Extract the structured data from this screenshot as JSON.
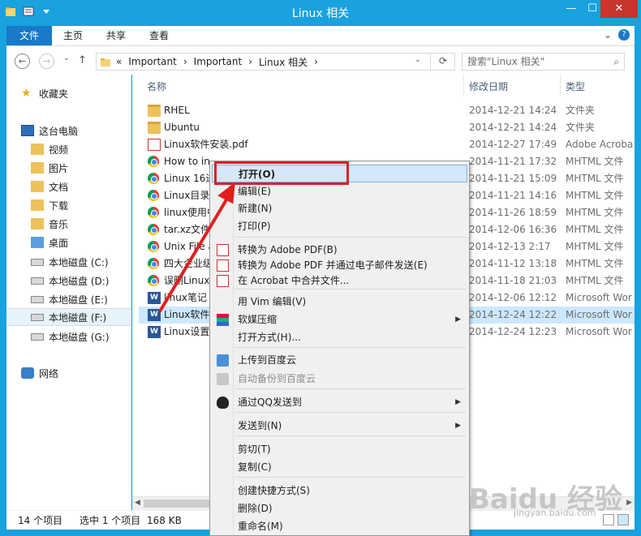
{
  "window": {
    "title": "Linux 相关"
  },
  "ribbon": {
    "tabs": [
      "文件",
      "主页",
      "共享",
      "查看"
    ]
  },
  "addressbar": {
    "path": [
      "«",
      "Important",
      "›",
      "Important",
      "›",
      "Linux 相关",
      "›"
    ],
    "search_placeholder": "搜索\"Linux 相关\""
  },
  "navpane": {
    "items": [
      {
        "label": "收藏夹",
        "icon": "star-icon"
      },
      {
        "label": "这台电脑",
        "icon": "computer-icon"
      },
      {
        "label": "视频",
        "icon": "folder-icon"
      },
      {
        "label": "图片",
        "icon": "folder-icon"
      },
      {
        "label": "文档",
        "icon": "folder-icon"
      },
      {
        "label": "下载",
        "icon": "folder-icon"
      },
      {
        "label": "音乐",
        "icon": "folder-icon"
      },
      {
        "label": "桌面",
        "icon": "folder-icon"
      },
      {
        "label": "本地磁盘 (C:)",
        "icon": "drive-icon"
      },
      {
        "label": "本地磁盘 (D:)",
        "icon": "drive-icon"
      },
      {
        "label": "本地磁盘 (E:)",
        "icon": "drive-icon"
      },
      {
        "label": "本地磁盘 (F:)",
        "icon": "drive-icon"
      },
      {
        "label": "本地磁盘 (G:)",
        "icon": "drive-icon"
      },
      {
        "label": "网络",
        "icon": "network-icon"
      }
    ]
  },
  "filelist": {
    "columns": {
      "name": "名称",
      "date": "修改日期",
      "type": "类型"
    },
    "rows": [
      {
        "name": "RHEL",
        "date": "2014-12-21 14:24",
        "type": "文件夹",
        "icon": "folder"
      },
      {
        "name": "Ubuntu",
        "date": "2014-12-21 14:24",
        "type": "文件夹",
        "icon": "folder"
      },
      {
        "name": "Linux软件安装.pdf",
        "date": "2014-12-27 17:49",
        "type": "Adobe Acroba",
        "icon": "pdf"
      },
      {
        "name": "How to in",
        "date": "2014-11-21 17:32",
        "type": "MHTML 文件",
        "icon": "chrome"
      },
      {
        "name": "Linux 16进",
        "date": "2014-11-21 15:09",
        "type": "MHTML 文件",
        "icon": "chrome"
      },
      {
        "name": "Linux目录",
        "date": "2014-11-21 14:16",
        "type": "MHTML 文件",
        "icon": "chrome"
      },
      {
        "name": "linux使用中",
        "date": "2014-11-26 18:59",
        "type": "MHTML 文件",
        "icon": "chrome"
      },
      {
        "name": "tar.xz文件",
        "date": "2014-12-06 16:36",
        "type": "MHTML 文件",
        "icon": "chrome"
      },
      {
        "name": "Unix File a",
        "date": "2014-12-13 2:17",
        "type": "MHTML 文件",
        "icon": "chrome"
      },
      {
        "name": "四大企业级",
        "date": "2014-11-12 13:18",
        "type": "MHTML 文件",
        "icon": "chrome"
      },
      {
        "name": "误删Linux",
        "date": "2014-11-18 21:03",
        "type": "MHTML 文件",
        "icon": "chrome"
      },
      {
        "name": "linux笔记",
        "date": "2014-12-06 12:12",
        "type": "Microsoft Wor",
        "icon": "word"
      },
      {
        "name": "Linux软件",
        "date": "2014-12-24 12:22",
        "type": "Microsoft Wor",
        "icon": "word"
      },
      {
        "name": "Linux设置",
        "date": "2014-12-24 12:23",
        "type": "Microsoft Wor",
        "icon": "word"
      }
    ],
    "selected_index": 12
  },
  "status": {
    "count": "14 个项目",
    "selection": "选中 1 个项目",
    "size": "168 KB"
  },
  "context_menu": {
    "items": [
      {
        "label": "打开(O)",
        "bold": true,
        "highlight": true
      },
      {
        "label": "编辑(E)"
      },
      {
        "label": "新建(N)"
      },
      {
        "label": "打印(P)"
      },
      {
        "label": "转换为 Adobe PDF(B)",
        "icon": "pdf-convert-icon"
      },
      {
        "label": "转换为 Adobe PDF 并通过电子邮件发送(E)",
        "icon": "pdf-email-icon"
      },
      {
        "label": "在 Acrobat 中合并文件...",
        "icon": "acrobat-merge-icon"
      },
      {
        "label": "用 Vim 编辑(V)"
      },
      {
        "label": "软媒压缩",
        "icon": "archive-icon",
        "submenu": true
      },
      {
        "label": "打开方式(H)..."
      },
      {
        "label": "上传到百度云",
        "icon": "baidu-cloud-icon"
      },
      {
        "label": "自动备份到百度云",
        "icon": "baidu-backup-icon",
        "disabled": true
      },
      {
        "label": "通过QQ发送到",
        "icon": "qq-icon",
        "submenu": true
      },
      {
        "label": "发送到(N)",
        "submenu": true
      },
      {
        "label": "剪切(T)"
      },
      {
        "label": "复制(C)"
      },
      {
        "label": "创建快捷方式(S)"
      },
      {
        "label": "删除(D)"
      },
      {
        "label": "重命名(M)"
      }
    ]
  },
  "watermark": {
    "brand": "Baidu 经验",
    "url": "jingyan.baidu.com"
  },
  "colors": {
    "title_bar": "#19a2de",
    "annotation": "#e02020",
    "selection": "#cce8ff"
  }
}
